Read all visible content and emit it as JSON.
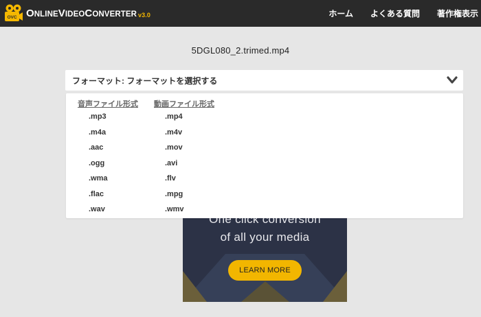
{
  "brand": {
    "name_parts": [
      "O",
      "NLINE",
      "V",
      "IDEO",
      "C",
      "ONVERTER"
    ],
    "version": "v3.0",
    "icon_text": "OVC",
    "icon_color": "#f5b800"
  },
  "nav": {
    "items": [
      "ホーム",
      "よくある質問",
      "著作権表示"
    ]
  },
  "file": {
    "name": "5DGL080_2.trimed.mp4"
  },
  "format_select": {
    "label": "フォーマット: フォーマットを選択する",
    "icon": "chevron-down-icon"
  },
  "dropdown": {
    "audio": {
      "heading": "音声ファイル形式",
      "options": [
        ".mp3",
        ".m4a",
        ".aac",
        ".ogg",
        ".wma",
        ".flac",
        ".wav"
      ]
    },
    "video": {
      "heading": "動画ファイル形式",
      "options": [
        ".mp4",
        ".m4v",
        ".mov",
        ".avi",
        ".flv",
        ".mpg",
        ".wmv"
      ]
    }
  },
  "ad": {
    "line1": "One click conversion",
    "line2": "of all your media",
    "button": "LEARN MORE",
    "button_color": "#f2b600"
  },
  "colors": {
    "topbar": "#2a2a2a",
    "page_bg": "#e6e6e6",
    "accent": "#f5b800"
  }
}
